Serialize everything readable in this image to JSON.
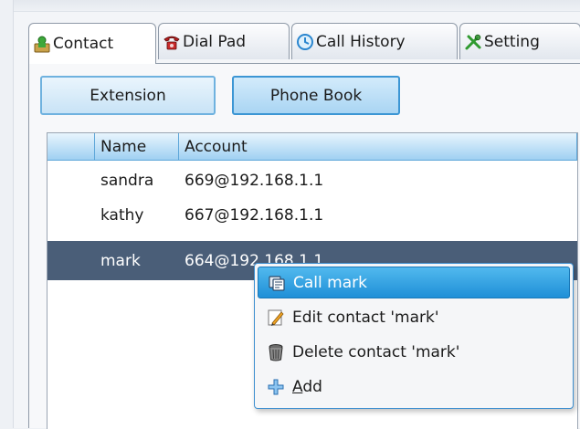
{
  "tabs": [
    {
      "label": "Contact",
      "icon": "contact-icon"
    },
    {
      "label": "Dial Pad",
      "icon": "telephone-icon"
    },
    {
      "label": "Call History",
      "icon": "call-history-icon"
    },
    {
      "label": "Setting",
      "icon": "tools-icon"
    }
  ],
  "buttons": {
    "extension": "Extension",
    "phone_book": "Phone Book"
  },
  "table": {
    "columns": [
      "",
      "Name",
      "Account"
    ],
    "rows": [
      {
        "name": "sandra",
        "account": "669@192.168.1.1"
      },
      {
        "name": "kathy",
        "account": "667@192.168.1.1"
      },
      {
        "name": "mark",
        "account": "664@192.168.1.1"
      }
    ]
  },
  "context_menu": {
    "items": [
      {
        "label": "Call mark",
        "icon": "call-icon"
      },
      {
        "label": "Edit contact 'mark'",
        "icon": "pencil-icon"
      },
      {
        "label": "Delete contact 'mark'",
        "icon": "trash-icon"
      },
      {
        "mnemonic": "A",
        "rest": "dd",
        "icon": "plus-icon"
      }
    ]
  },
  "colors": {
    "accent": "#1f8fd7",
    "header": "#9fd0f2",
    "selected_row": "#4a5e78"
  }
}
